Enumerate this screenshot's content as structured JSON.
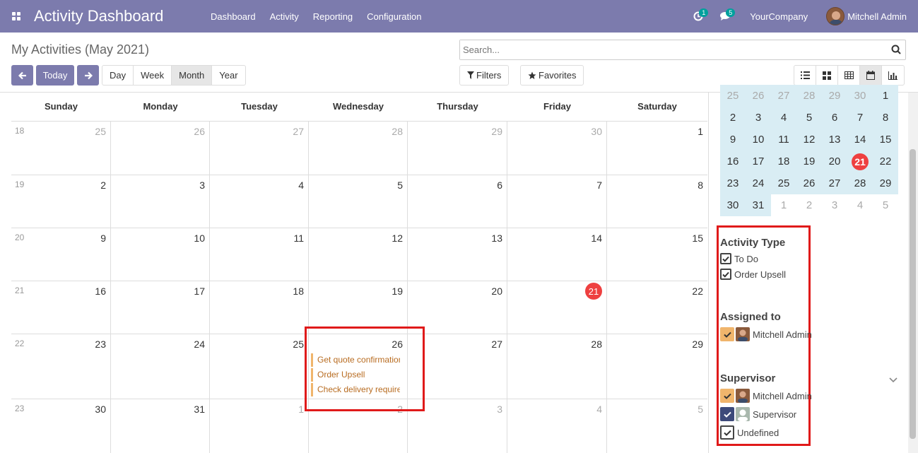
{
  "app": {
    "title": "Activity Dashboard"
  },
  "menu": [
    "Dashboard",
    "Activity",
    "Reporting",
    "Configuration"
  ],
  "systray": {
    "activity_count": "1",
    "message_count": "5",
    "company": "YourCompany",
    "user": "Mitchell Admin"
  },
  "control": {
    "page_title": "My Activities (May 2021)",
    "search_placeholder": "Search...",
    "today_label": "Today",
    "scales": [
      "Day",
      "Week",
      "Month",
      "Year"
    ],
    "active_scale": "Month",
    "filters_label": "Filters",
    "favorites_label": "Favorites"
  },
  "calendar": {
    "weekdays": [
      "Sunday",
      "Monday",
      "Tuesday",
      "Wednesday",
      "Thursday",
      "Friday",
      "Saturday"
    ],
    "weeks": [
      {
        "num": "18",
        "days": [
          "25",
          "26",
          "27",
          "28",
          "29",
          "30",
          "1"
        ]
      },
      {
        "num": "19",
        "days": [
          "2",
          "3",
          "4",
          "5",
          "6",
          "7",
          "8"
        ]
      },
      {
        "num": "20",
        "days": [
          "9",
          "10",
          "11",
          "12",
          "13",
          "14",
          "15"
        ]
      },
      {
        "num": "21",
        "days": [
          "16",
          "17",
          "18",
          "19",
          "20",
          "21",
          "22"
        ]
      },
      {
        "num": "22",
        "days": [
          "23",
          "24",
          "25",
          "26",
          "27",
          "28",
          "29"
        ]
      },
      {
        "num": "23",
        "days": [
          "30",
          "31",
          "1",
          "2",
          "3",
          "4",
          "5"
        ]
      }
    ],
    "events": [
      "Get quote confirmation",
      "Order Upsell",
      "Check delivery requirements"
    ]
  },
  "mini_calendar": {
    "weeks": [
      [
        "25",
        "26",
        "27",
        "28",
        "29",
        "30",
        "1"
      ],
      [
        "2",
        "3",
        "4",
        "5",
        "6",
        "7",
        "8"
      ],
      [
        "9",
        "10",
        "11",
        "12",
        "13",
        "14",
        "15"
      ],
      [
        "16",
        "17",
        "18",
        "19",
        "20",
        "21",
        "22"
      ],
      [
        "23",
        "24",
        "25",
        "26",
        "27",
        "28",
        "29"
      ],
      [
        "30",
        "31",
        "1",
        "2",
        "3",
        "4",
        "5"
      ]
    ],
    "today": "21"
  },
  "filters": {
    "activity_type": {
      "title": "Activity Type",
      "items": [
        "To Do",
        "Order Upsell"
      ]
    },
    "assigned_to": {
      "title": "Assigned to",
      "items": [
        "Mitchell Admin"
      ]
    },
    "supervisor": {
      "title": "Supervisor",
      "items": [
        "Mitchell Admin",
        "Supervisor",
        "Undefined"
      ]
    }
  },
  "colors": {
    "navbar": "#7c7bad",
    "today": "#ee4040",
    "event_border": "#f0b56c",
    "highlight": "#e01a1a"
  }
}
